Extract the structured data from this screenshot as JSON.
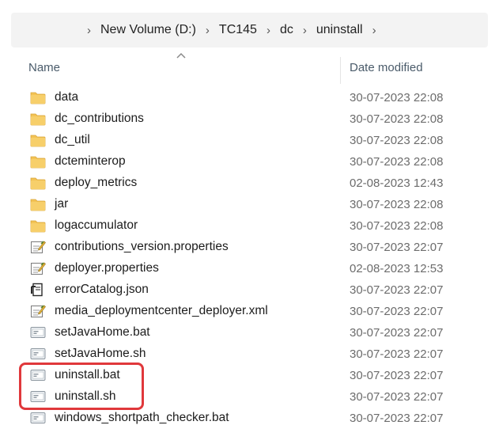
{
  "breadcrumb": [
    "New Volume (D:)",
    "TC145",
    "dc",
    "uninstall"
  ],
  "columns": {
    "name": "Name",
    "date": "Date modified"
  },
  "files": [
    {
      "name": "data",
      "date": "30-07-2023 22:08",
      "icon": "folder-icon"
    },
    {
      "name": "dc_contributions",
      "date": "30-07-2023 22:08",
      "icon": "folder-icon"
    },
    {
      "name": "dc_util",
      "date": "30-07-2023 22:08",
      "icon": "folder-icon"
    },
    {
      "name": "dcteminterop",
      "date": "30-07-2023 22:08",
      "icon": "folder-icon"
    },
    {
      "name": "deploy_metrics",
      "date": "02-08-2023 12:43",
      "icon": "folder-icon"
    },
    {
      "name": "jar",
      "date": "30-07-2023 22:08",
      "icon": "folder-icon"
    },
    {
      "name": "logaccumulator",
      "date": "30-07-2023 22:08",
      "icon": "folder-icon"
    },
    {
      "name": "contributions_version.properties",
      "date": "30-07-2023 22:07",
      "icon": "properties-file-icon"
    },
    {
      "name": "deployer.properties",
      "date": "02-08-2023 12:53",
      "icon": "properties-file-icon"
    },
    {
      "name": "errorCatalog.json",
      "date": "30-07-2023 22:07",
      "icon": "json-file-icon"
    },
    {
      "name": "media_deploymentcenter_deployer.xml",
      "date": "30-07-2023 22:07",
      "icon": "xml-file-icon"
    },
    {
      "name": "setJavaHome.bat",
      "date": "30-07-2023 22:07",
      "icon": "script-file-icon"
    },
    {
      "name": "setJavaHome.sh",
      "date": "30-07-2023 22:07",
      "icon": "script-file-icon"
    },
    {
      "name": "uninstall.bat",
      "date": "30-07-2023 22:07",
      "icon": "script-file-icon"
    },
    {
      "name": "uninstall.sh",
      "date": "30-07-2023 22:07",
      "icon": "script-file-icon"
    },
    {
      "name": "windows_shortpath_checker.bat",
      "date": "30-07-2023 22:07",
      "icon": "script-file-icon"
    }
  ],
  "highlighted_files": [
    "uninstall.bat",
    "uninstall.sh"
  ],
  "colors": {
    "highlight": "#e0383b",
    "folder": "#f3c355"
  }
}
